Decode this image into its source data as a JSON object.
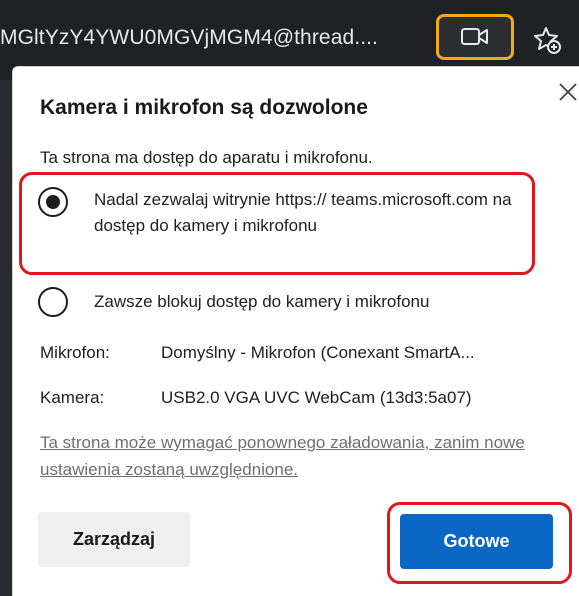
{
  "browser": {
    "url_text": "MGltYzY4YWU0MGVjMGM4@thread....",
    "camera_icon": "video-camera-icon",
    "favorite_icon": "star-add-icon"
  },
  "popup": {
    "title": "Kamera i mikrofon są dozwolone",
    "subtitle": "Ta strona ma dostęp do aparatu i mikrofonu.",
    "options": [
      {
        "label": "Nadal zezwalaj witrynie https:// teams.microsoft.com na dostęp do kamery i mikrofonu",
        "selected": true
      },
      {
        "label": "Zawsze blokuj dostęp do kamery i mikrofonu",
        "selected": false
      }
    ],
    "microphone": {
      "label": "Mikrofon:",
      "value": "Domyślny - Mikrofon (Conexant SmartA..."
    },
    "camera": {
      "label": "Kamera:",
      "value": "USB2.0 VGA UVC WebCam (13d3:5a07)"
    },
    "notice": "Ta strona może wymagać ponownego załadowania, zanim nowe ustawienia zostaną uwzględnione.",
    "manage_button": "Zarządzaj",
    "done_button": "Gotowe"
  },
  "colors": {
    "accent": "#0b67c4",
    "highlight_red": "#e0171c",
    "highlight_orange": "#f3a81c",
    "browser_bar": "#202124"
  }
}
